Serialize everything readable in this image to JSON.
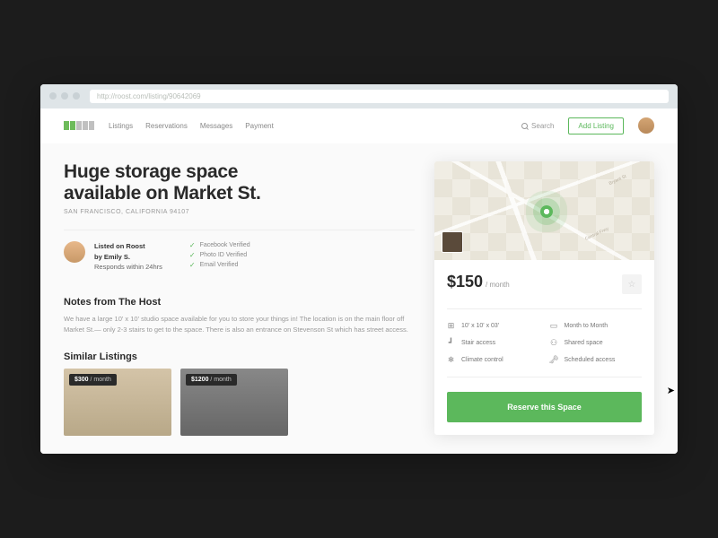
{
  "browser": {
    "url": "http://roost.com/listing/90642069"
  },
  "nav": {
    "links": [
      "Listings",
      "Reservations",
      "Messages",
      "Payment"
    ],
    "search": "Search",
    "add": "Add Listing"
  },
  "listing": {
    "title1": "Huge storage space",
    "title2": "available on Market St.",
    "location": "SAN FRANCISCO, CALIFORNIA 94107",
    "host": {
      "listed": "Listed on Roost",
      "by": "by Emily S.",
      "responds": "Responds within 24hrs"
    },
    "verified": [
      "Facebook Verified",
      "Photo ID Verified",
      "Email Verified"
    ],
    "notes_heading": "Notes from The Host",
    "notes": "We have a large 10' x 10' studio space available for you to store your things in! The location is on the main floor off Market St.— only 2-3 stairs to get to the space. There is also an entrance on Stevenson St which has street access.",
    "similar_heading": "Similar Listings",
    "similar": [
      {
        "price": "$300",
        "per": "/ month"
      },
      {
        "price": "$1200",
        "per": "/ month"
      }
    ]
  },
  "panel": {
    "streets": [
      "Bryant St",
      "Central Frwy"
    ],
    "price": "$150",
    "per": "/ month",
    "features": [
      "10' x 10' x 03'",
      "Month to Month",
      "Stair access",
      "Shared space",
      "Climate control",
      "Scheduled access"
    ],
    "reserve": "Reserve this Space"
  }
}
